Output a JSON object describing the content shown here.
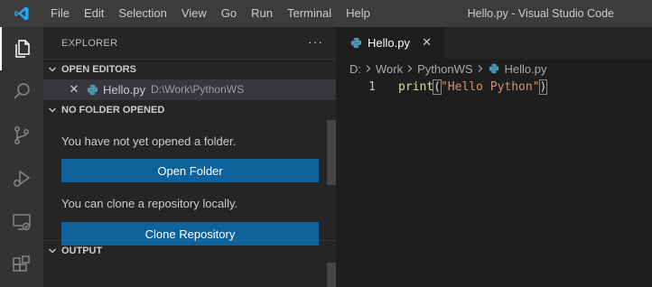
{
  "titlebar": {
    "menu": [
      "File",
      "Edit",
      "Selection",
      "View",
      "Go",
      "Run",
      "Terminal",
      "Help"
    ],
    "window_title": "Hello.py - Visual Studio Code",
    "icon": "vscode-logo"
  },
  "activitybar": {
    "items": [
      {
        "name": "explorer-icon",
        "active": true
      },
      {
        "name": "search-icon",
        "active": false
      },
      {
        "name": "source-control-icon",
        "active": false
      },
      {
        "name": "run-debug-icon",
        "active": false
      },
      {
        "name": "remote-explorer-icon",
        "active": false
      },
      {
        "name": "extensions-icon",
        "active": false
      }
    ]
  },
  "sidebar": {
    "title": "EXPLORER",
    "more": "···",
    "open_editors": {
      "header": "OPEN EDITORS",
      "items": [
        {
          "close": "✕",
          "filename": "Hello.py",
          "path": "D:\\Work\\PythonWS"
        }
      ]
    },
    "no_folder": {
      "header": "NO FOLDER OPENED",
      "message_open": "You have not yet opened a folder.",
      "open_button": "Open Folder",
      "message_clone": "You can clone a repository locally.",
      "clone_button": "Clone Repository"
    },
    "output": {
      "header": "OUTPUT"
    }
  },
  "editor": {
    "tab": {
      "label": "Hello.py",
      "close": "✕"
    },
    "breadcrumbs": [
      "D:",
      "Work",
      "PythonWS",
      "Hello.py"
    ],
    "lines": [
      {
        "number": "1",
        "fn": "print",
        "open": "(",
        "str": "\"Hello Python\"",
        "close": ")"
      }
    ]
  },
  "colors": {
    "accent_button": "#0e639c",
    "python_icon": "#519aba",
    "string": "#ce9178",
    "function": "#dcdcaa"
  }
}
